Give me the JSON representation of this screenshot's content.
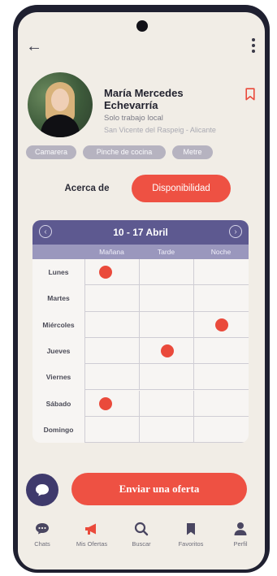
{
  "profile": {
    "name": "María Mercedes Echevarría",
    "subtitle": "Solo trabajo local",
    "location": "San Vicente del Raspeig - Alicante"
  },
  "tags": [
    "Camarera",
    "Pinche de cocina",
    "Metre"
  ],
  "tabs": {
    "about": "Acerca de",
    "availability": "Disponibilidad"
  },
  "calendar": {
    "range": "10 - 17 Abril",
    "columns": [
      "Mañana",
      "Tarde",
      "Noche"
    ],
    "days": [
      {
        "label": "Lunes",
        "slots": [
          true,
          false,
          false
        ]
      },
      {
        "label": "Martes",
        "slots": [
          false,
          false,
          false
        ]
      },
      {
        "label": "Miércoles",
        "slots": [
          false,
          false,
          true
        ]
      },
      {
        "label": "Jueves",
        "slots": [
          false,
          true,
          false
        ]
      },
      {
        "label": "Viernes",
        "slots": [
          false,
          false,
          false
        ]
      },
      {
        "label": "Sábado",
        "slots": [
          true,
          false,
          false
        ]
      },
      {
        "label": "Domingo",
        "slots": [
          false,
          false,
          false
        ]
      }
    ]
  },
  "actions": {
    "send_offer": "Enviar una oferta"
  },
  "nav": [
    {
      "label": "Chats",
      "icon": "chat-icon"
    },
    {
      "label": "Mis Ofertas",
      "icon": "megaphone-icon"
    },
    {
      "label": "Buscar",
      "icon": "search-icon"
    },
    {
      "label": "Favoritos",
      "icon": "bookmark-icon"
    },
    {
      "label": "Perfil",
      "icon": "user-icon"
    }
  ],
  "colors": {
    "accent": "#ee5143",
    "calendar_header": "#5d5990",
    "column_header": "#9a97bd",
    "tag": "#b6b3c0",
    "chat_button": "#3f3a6c",
    "background": "#f1ede6"
  }
}
